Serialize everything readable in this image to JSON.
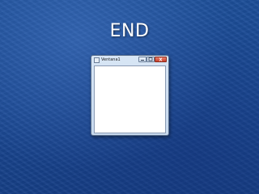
{
  "slide": {
    "title": "END"
  },
  "window": {
    "title": "Ventana1",
    "controls": {
      "minimize_icon": "minimize-icon",
      "maximize_icon": "maximize-icon",
      "close_icon": "close-icon"
    }
  },
  "colors": {
    "background": "#1a4893",
    "title_text": "#ffffff",
    "close_button": "#c7402b"
  }
}
